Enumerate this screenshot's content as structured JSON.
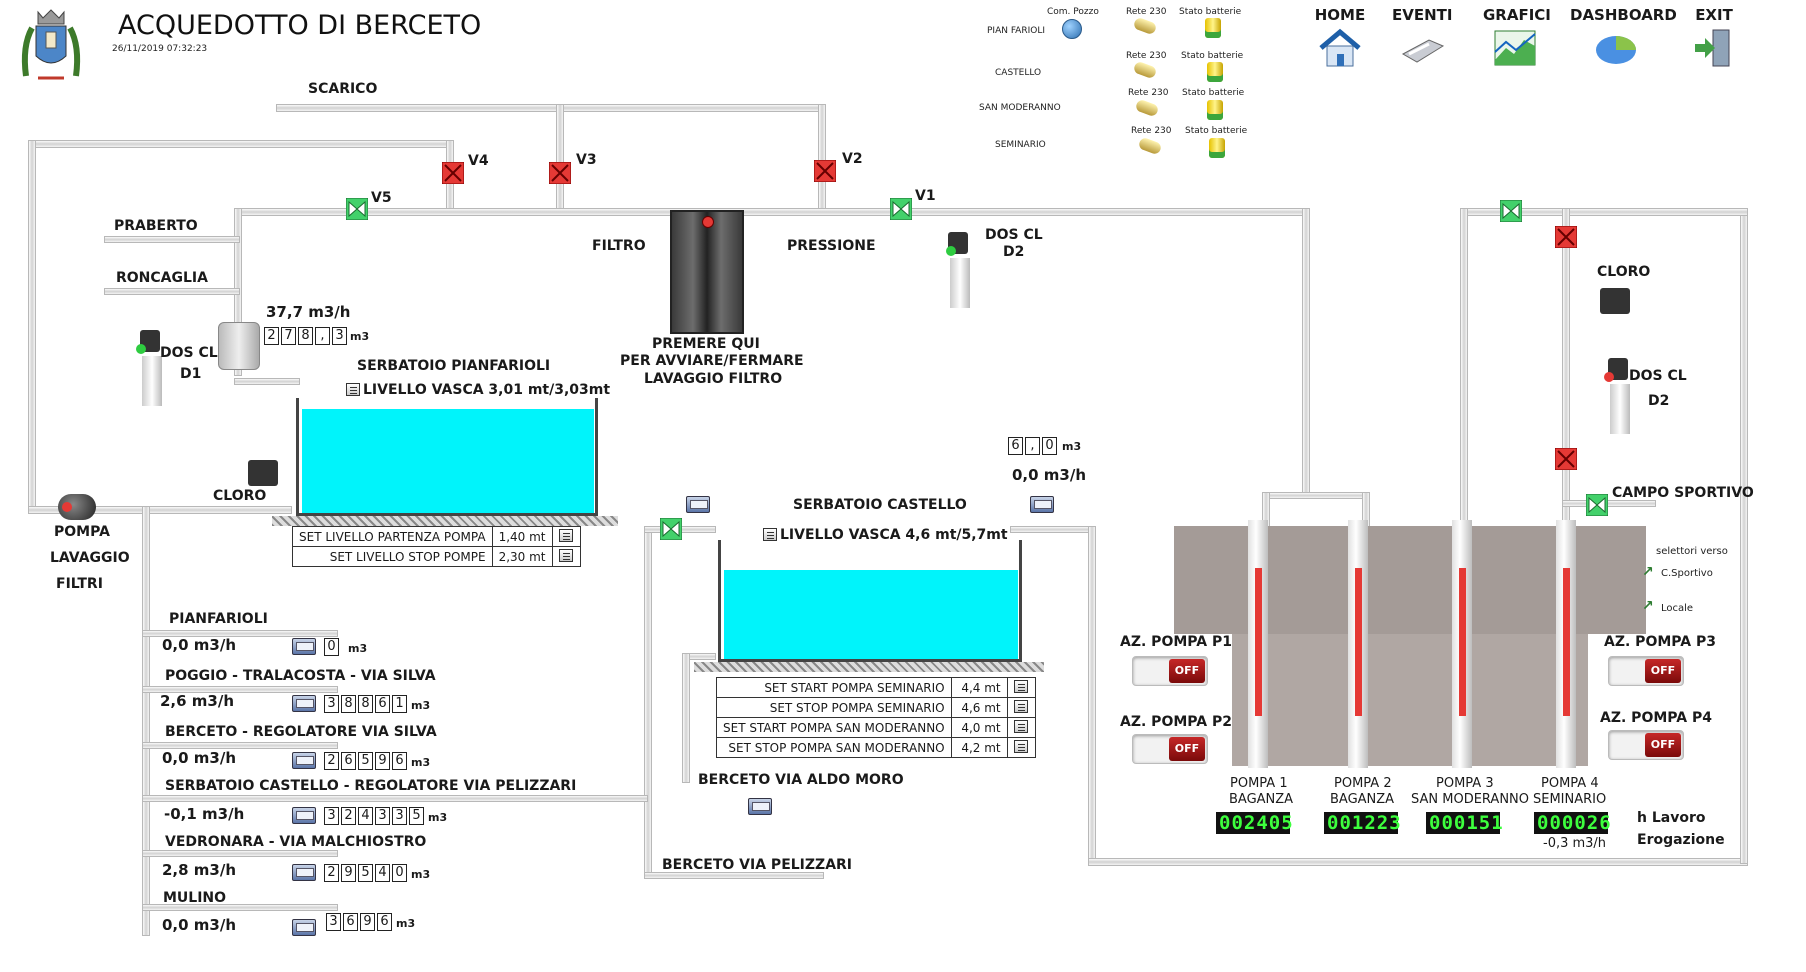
{
  "header": {
    "title": "ACQUEDOTTO DI BERCETO",
    "datetime": "26/11/2019 07:32:23"
  },
  "nav": [
    {
      "label": "HOME",
      "icon": "home-icon"
    },
    {
      "label": "EVENTI",
      "icon": "events-icon"
    },
    {
      "label": "GRAFICI",
      "icon": "chart-icon"
    },
    {
      "label": "DASHBOARD",
      "icon": "dashboard-icon"
    },
    {
      "label": "EXIT",
      "icon": "exit-icon"
    }
  ],
  "status": {
    "com_pozzo": "Com. Pozzo",
    "rete": "Rete 230",
    "stato": "Stato batterie",
    "sites": [
      "PIAN FARIOLI",
      "CASTELLO",
      "SAN MODERANNO",
      "SEMINARIO"
    ]
  },
  "valves": {
    "v1": "V1",
    "v2": "V2",
    "v3": "V3",
    "v4": "V4",
    "v5": "V5"
  },
  "labels": {
    "scarico": "SCARICO",
    "praberto": "PRABERTO",
    "roncaglia": "RONCAGLIA",
    "filtro": "FILTRO",
    "pressione": "PRESSIONE",
    "dos_cl": "DOS CL",
    "d1": "D1",
    "d2": "D2",
    "cloro": "CLORO",
    "pompa_lavaggio": [
      "POMPA",
      "LAVAGGIO",
      "FILTRI"
    ],
    "filtro_cmd": [
      "PREMERE QUI",
      "PER AVVIARE/FERMARE",
      "LAVAGGIO FILTRO"
    ],
    "campo_sportivo": "CAMPO SPORTIVO",
    "selettori": "selettori verso",
    "c_sportivo": "C.Sportivo",
    "locale": "Locale",
    "berceto_aldo_moro": "BERCETO VIA ALDO MORO",
    "berceto_pelizzari": "BERCETO VIA PELIZZARI",
    "h_lavoro": "h Lavoro",
    "erogazione": "Erogazione"
  },
  "pianfarioli": {
    "flow": "37,7 m3/h",
    "counter": [
      "2",
      "7",
      "8",
      ",",
      "3"
    ],
    "unit": "m3",
    "title": "SERBATOIO PIANFARIOLI",
    "level": "LIVELLO VASCA  3,01 mt/3,03mt",
    "settings": [
      {
        "k": "SET LIVELLO PARTENZA POMPA",
        "v": "1,40 mt"
      },
      {
        "k": "SET LIVELLO STOP POMPE",
        "v": "2,30 mt"
      }
    ],
    "level_fraction": 0.99
  },
  "castello": {
    "flow": "0,0 m3/h",
    "counter": [
      "6",
      ",",
      "0"
    ],
    "unit": "m3",
    "title": "SERBATOIO CASTELLO",
    "level": "LIVELLO VASCA  4,6 mt/5,7mt",
    "settings": [
      {
        "k": "SET START POMPA SEMINARIO",
        "v": "4,4 mt"
      },
      {
        "k": "SET STOP POMPA SEMINARIO",
        "v": "4,6 mt"
      },
      {
        "k": "SET START POMPA SAN MODERANNO",
        "v": "4,0 mt"
      },
      {
        "k": "SET STOP POMPA SAN MODERANNO",
        "v": "4,2 mt"
      }
    ],
    "level_fraction": 0.81
  },
  "distribution": [
    {
      "name": "PIANFARIOLI",
      "flow": "0,0 m3/h",
      "counter": [
        "0"
      ],
      "unit": "m3"
    },
    {
      "name": "POGGIO - TRALACOSTA - VIA SILVA",
      "flow": "2,6 m3/h",
      "counter": [
        "3",
        "8",
        "8",
        "6",
        "1"
      ],
      "unit": "m3"
    },
    {
      "name": "BERCETO - REGOLATORE VIA SILVA",
      "flow": "0,0 m3/h",
      "counter": [
        "2",
        "6",
        "5",
        "9",
        "6"
      ],
      "unit": "m3"
    },
    {
      "name": "SERBATOIO CASTELLO - REGOLATORE VIA PELIZZARI",
      "flow": "-0,1 m3/h",
      "counter": [
        "3",
        "2",
        "4",
        "3",
        "3",
        "5"
      ],
      "unit": "m3"
    },
    {
      "name": "VEDRONARA - VIA MALCHIOSTRO",
      "flow": "2,8 m3/h",
      "counter": [
        "2",
        "9",
        "5",
        "4",
        "0"
      ],
      "unit": "m3"
    },
    {
      "name": "MULINO",
      "flow": "0,0 m3/h",
      "counter": [
        "3",
        "6",
        "9",
        "6"
      ],
      "unit": "m3"
    }
  ],
  "pumps_control": [
    {
      "label": "AZ. POMPA P1",
      "state": "OFF"
    },
    {
      "label": "AZ. POMPA P2",
      "state": "OFF"
    },
    {
      "label": "AZ. POMPA P3",
      "state": "OFF"
    },
    {
      "label": "AZ. POMPA P4",
      "state": "OFF"
    }
  ],
  "wells": [
    {
      "name1": "POMPA 1",
      "name2": "BAGANZA",
      "hours": "002405",
      "flow": ""
    },
    {
      "name1": "POMPA 2",
      "name2": "BAGANZA",
      "hours": "001223",
      "flow": ""
    },
    {
      "name1": "POMPA 3",
      "name2": "SAN MODERANNO",
      "hours": "000151",
      "flow": ""
    },
    {
      "name1": "POMPA 4",
      "name2": "SEMINARIO",
      "hours": "000026",
      "flow": "-0,3 m3/h"
    }
  ],
  "colors": {
    "water": "#00f4fb",
    "valve_closed": "#e53935",
    "valve_open": "#43d16b",
    "led": "#3dff3d"
  }
}
